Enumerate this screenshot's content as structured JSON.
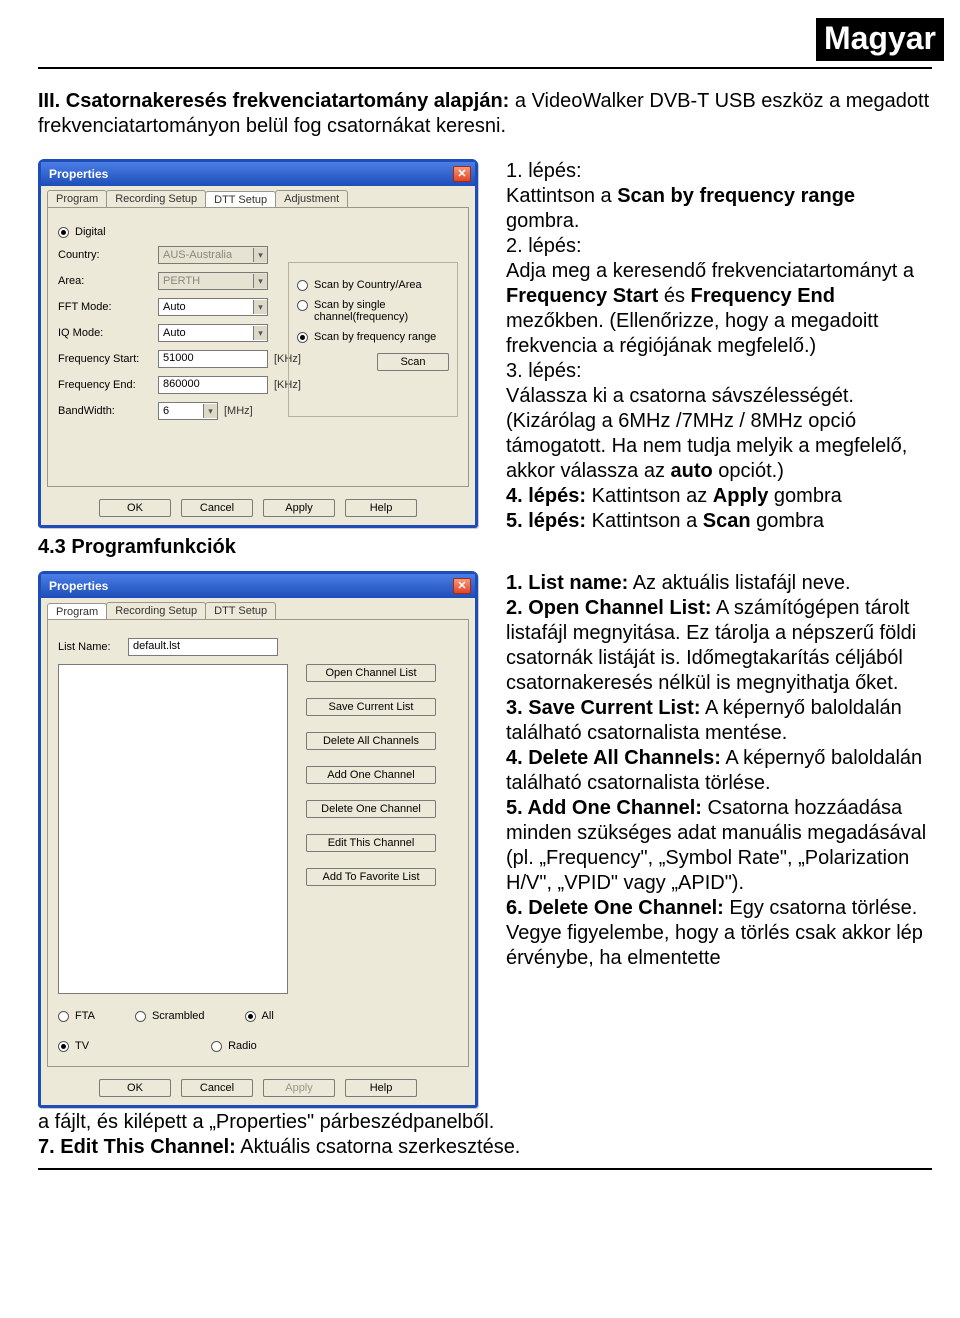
{
  "badge": "Magyar",
  "intro_strong": "III. Csatornakeresés frekvenciatartomány alapján:",
  "intro_rest": " a VideoWalker DVB-T USB eszköz a megadott frekvenciatartományon belül fog csatornákat keresni.",
  "section_title": "4.3 Programfunkciók",
  "steps1": {
    "s1a": "1. lépés:",
    "s1b": "Kattintson a ",
    "s1c": "Scan by frequency range",
    "s1d": " gombra.",
    "s2a": "2. lépés:",
    "s2b": "Adja meg a keresendő frekvenciatartományt a ",
    "s2c": "Frequency Start",
    "s2d": " és ",
    "s2e": "Frequency End",
    "s2f": " mezőkben. (Ellenőrizze, hogy a megadoitt frekvencia a régiójának megfelelő.)",
    "s3a": "3. lépés:",
    "s3b": "Válassza ki a csatorna sávszélességét. (Kizárólag a 6MHz /7MHz / 8MHz opció támogatott. Ha nem tudja melyik a megfelelő, akkor válassza az ",
    "s3c": "auto",
    "s3d": " opciót.)",
    "s4a": "4. lépés:",
    "s4b": " Kattintson az ",
    "s4c": "Apply",
    "s4d": " gombra",
    "s5a": "5. lépés:",
    "s5b": " Kattintson a ",
    "s5c": "Scan",
    "s5d": " gombra"
  },
  "steps2": {
    "i1a": "1. List name:",
    "i1b": " Az aktuális listafájl neve.",
    "i2a": "2. Open Channel List:",
    "i2b": " A számítógépen tárolt listafájl megnyitása. Ez tárolja a népszerű földi csatornák listáját is. Időmegtakarítás céljából csatornakeresés nélkül is megnyithatja őket.",
    "i3a": "3. Save Current List:",
    "i3b": " A képernyő baloldalán található csatornalista mentése.",
    "i4a": "4. Delete All Channels:",
    "i4b": " A képernyő baloldalán található csatornalista törlése.",
    "i5a": "5. Add One Channel:",
    "i5b": " Csatorna hozzáadása minden szükséges adat manuális megadásával (pl. „Frequency\", „Symbol Rate\", „Polarization H/V\", „VPID\" vagy „APID\").",
    "i6a": "6. Delete One Channel:",
    "i6b": " Egy csatorna törlése. Vegye figyelembe, hogy a törlés csak akkor lép érvénybe, ha elmentette",
    "i6c": "a fájlt, és kilépett a „Properties\" párbeszédpanelből.",
    "i7a": "7. Edit This Channel:",
    "i7b": " Aktuális csatorna szerkesztése."
  },
  "win1": {
    "title": "Properties",
    "tabs": [
      "Program",
      "Recording Setup",
      "DTT Setup",
      "Adjustment"
    ],
    "radio_digital": "Digital",
    "lbl_country": "Country:",
    "val_country": "AUS-Australia",
    "lbl_area": "Area:",
    "val_area": "PERTH",
    "lbl_fft": "FFT Mode:",
    "val_fft": "Auto",
    "lbl_iq": "IQ Mode:",
    "val_iq": "Auto",
    "lbl_fs": "Frequency Start:",
    "val_fs": "51000",
    "unit_fs": "[KHz]",
    "lbl_fe": "Frequency End:",
    "val_fe": "860000",
    "unit_fe": "[KHz]",
    "lbl_bw": "BandWidth:",
    "val_bw": "6",
    "unit_bw": "[MHz]",
    "scan_opt1": "Scan by Country/Area",
    "scan_opt2": "Scan by single channel(frequency)",
    "scan_opt3": "Scan by frequency range",
    "btn_scan": "Scan",
    "btn_ok": "OK",
    "btn_cancel": "Cancel",
    "btn_apply": "Apply",
    "btn_help": "Help"
  },
  "win2": {
    "title": "Properties",
    "tabs": [
      "Program",
      "Recording Setup",
      "DTT Setup"
    ],
    "lbl_listname": "List Name:",
    "val_listname": "default.lst",
    "btn_open": "Open Channel List",
    "btn_save": "Save Current List",
    "btn_delall": "Delete All Channels",
    "btn_addone": "Add One Channel",
    "btn_delone": "Delete One Channel",
    "btn_edit": "Edit This Channel",
    "btn_addfav": "Add To Favorite List",
    "radio_fta": "FTA",
    "radio_scr": "Scrambled",
    "radio_all": "All",
    "radio_tv": "TV",
    "radio_radio": "Radio",
    "btn_ok": "OK",
    "btn_cancel": "Cancel",
    "btn_apply": "Apply",
    "btn_help": "Help"
  }
}
